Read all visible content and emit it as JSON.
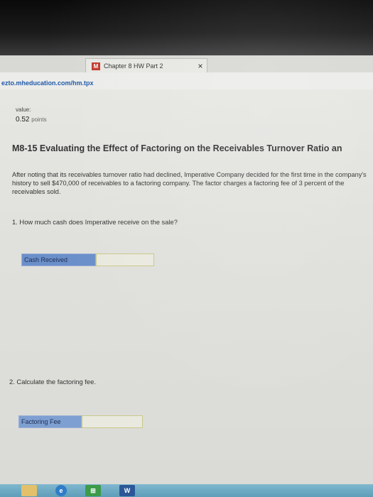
{
  "browser": {
    "tab_title": "Chapter 8 HW Part 2",
    "favicon": "M",
    "close_glyph": "×",
    "url": "ezto.mheducation.com/hm.tpx"
  },
  "assignment": {
    "value_label": "value:",
    "value_amount": "0.52",
    "value_unit": "points",
    "question_id": "M8-15",
    "question_title": "Evaluating the Effect of Factoring on the Receivables Turnover Ratio an",
    "problem_text": "After noting that its receivables turnover ratio had declined, Imperative Company decided for the first time in the company's history to sell $470,000 of receivables to a factoring company. The factor charges a factoring fee of 3 percent of the receivables sold.",
    "q1_text": "1. How much cash does Imperative receive on the sale?",
    "q1_label": "Cash Received",
    "q1_value": "",
    "q2_text": "2. Calculate the factoring fee.",
    "q2_label": "Factoring Fee",
    "q2_value": ""
  },
  "taskbar": {
    "icons": [
      "file-explorer-icon",
      "internet-explorer-icon",
      "store-icon",
      "word-icon"
    ],
    "word_glyph": "W",
    "ie_glyph": "e",
    "store_glyph": "⊞"
  },
  "colors": {
    "label_bg": "#6b8fc9",
    "url_text": "#1d5aa8",
    "taskbar": "#6aa7c1"
  }
}
